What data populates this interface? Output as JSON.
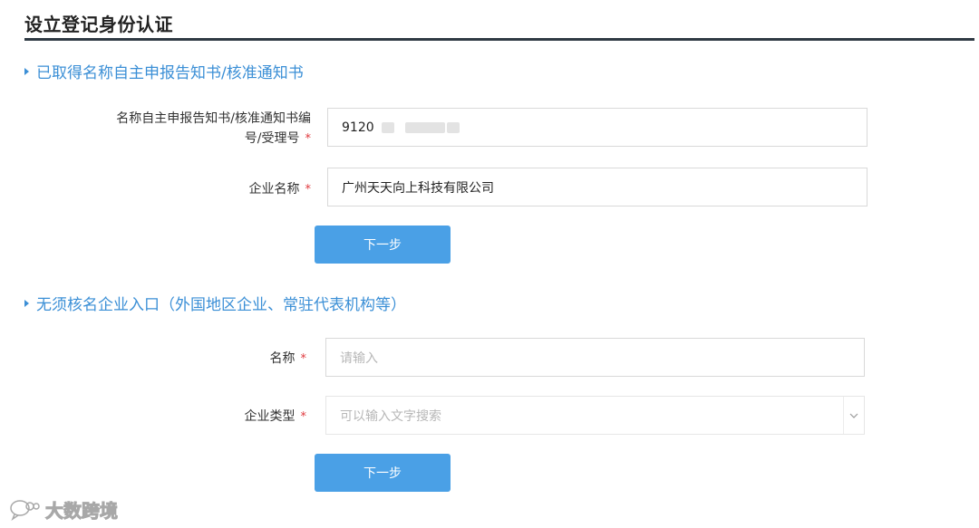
{
  "page": {
    "title": "设立登记身份认证"
  },
  "section_named": {
    "heading": "已取得名称自主申报告知书/核准通知书",
    "notice_label_line1": "名称自主申报告知书/核准通知书编",
    "notice_label_line2": "号/受理号",
    "notice_value_visible": "9120",
    "company_label": "企业名称",
    "company_value": "广州天天向上科技有限公司",
    "required_mark": "*",
    "next_button": "下一步"
  },
  "section_unnamed": {
    "heading": "无须核名企业入口（外国地区企业、常驻代表机构等）",
    "name_label": "名称",
    "name_placeholder": "请输入",
    "type_label": "企业类型",
    "type_placeholder": "可以输入文字搜索",
    "required_mark": "*",
    "next_button": "下一步"
  },
  "watermark": {
    "text": "大数跨境"
  },
  "colors": {
    "accent": "#3b8fd6",
    "button": "#4aa0e6",
    "required": "#e0393e",
    "title_rule": "#2f3a44"
  },
  "icons": {
    "section_marker": "triangle-right-icon",
    "select_arrow": "chevron-down-icon",
    "watermark_logo": "wechat-logo-icon"
  }
}
